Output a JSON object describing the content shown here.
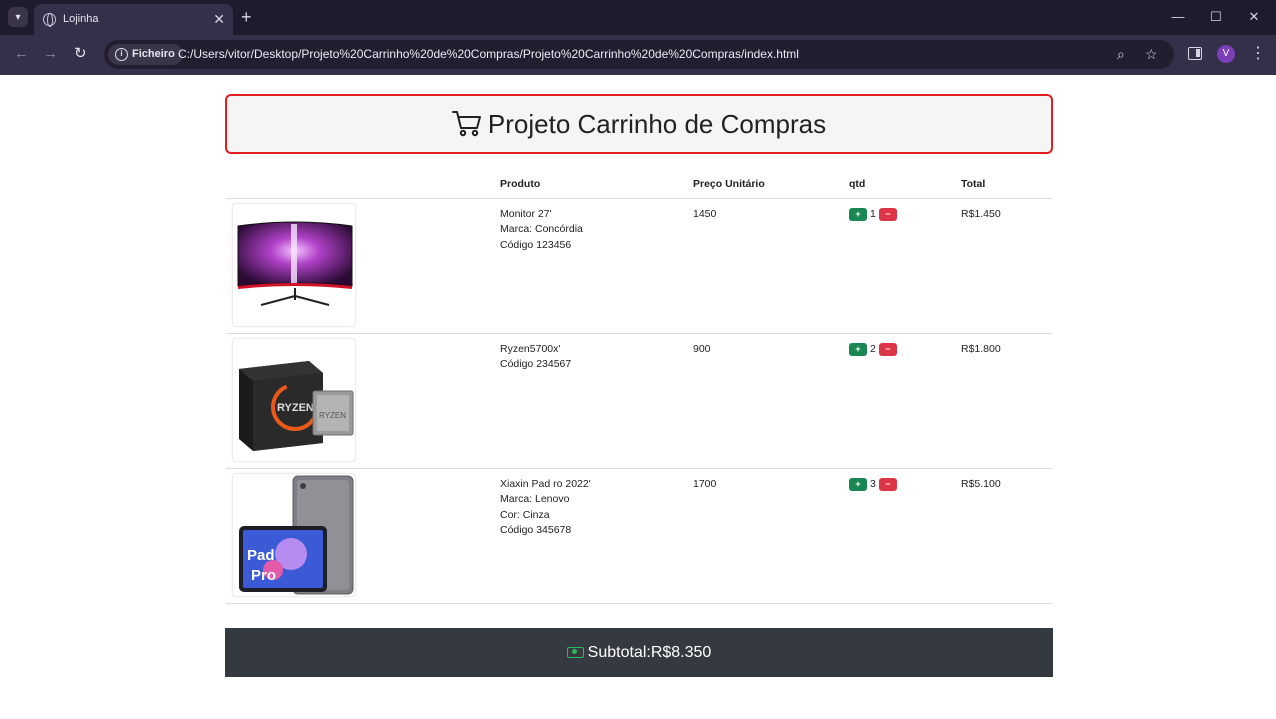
{
  "browser": {
    "tab_title": "Lojinha",
    "security_label": "Ficheiro",
    "url": "C:/Users/vitor/Desktop/Projeto%20Carrinho%20de%20Compras/Projeto%20Carrinho%20de%20Compras/index.html",
    "avatar_letter": "V"
  },
  "header": {
    "title": "Projeto Carrinho de Compras"
  },
  "table": {
    "columns": [
      "",
      "Produto",
      "Preço Unitário",
      "qtd",
      "Total"
    ],
    "rows": [
      {
        "image": "monitor",
        "details": [
          "Monitor 27'",
          "Marca: Concórdia",
          "Código 123456"
        ],
        "price": "1450",
        "qty": "1",
        "total": "R$1.450"
      },
      {
        "image": "processor",
        "details": [
          "Ryzen5700x'",
          "Código 234567"
        ],
        "price": "900",
        "qty": "2",
        "total": "R$1.800"
      },
      {
        "image": "tablet",
        "details": [
          "Xiaxin Pad ro 2022'",
          "Marca: Lenovo",
          "Cor: Cinza",
          "Código 345678"
        ],
        "price": "1700",
        "qty": "3",
        "total": "R$5.100"
      }
    ]
  },
  "buttons": {
    "plus": "+",
    "minus": "−"
  },
  "subtotal": {
    "label": "Subtotal:",
    "value": "R$8.350"
  },
  "colors": {
    "accent_red": "#e02020",
    "plus_green": "#198754",
    "minus_red": "#dc3545",
    "subtotal_bg": "#343a40"
  }
}
